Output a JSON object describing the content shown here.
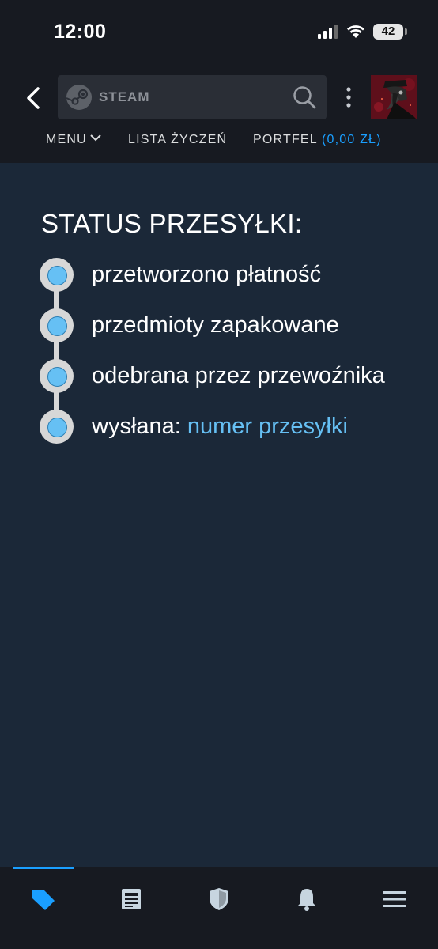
{
  "statusbar": {
    "time": "12:00",
    "battery": "42",
    "icons": [
      "signal-icon",
      "wifi-icon",
      "battery-icon"
    ]
  },
  "header": {
    "search_logo_text": "STEAM",
    "nav": {
      "menu_label": "MENU",
      "wishlist_label": "LISTA ŻYCZEŃ",
      "wallet_label": "PORTFEL",
      "wallet_balance": "(0,00 ZŁ)"
    }
  },
  "main": {
    "title": "STATUS PRZESYŁKI:",
    "steps": [
      {
        "label": "przetworzono płatność"
      },
      {
        "label": "przedmioty zapakowane"
      },
      {
        "label": "odebrana przez przewoźnika"
      },
      {
        "label": "wysłana:",
        "link": "numer przesyłki"
      }
    ]
  },
  "tabbar": {
    "tabs": [
      "store-tag-icon",
      "news-icon",
      "shield-icon",
      "bell-icon",
      "menu-icon"
    ],
    "active": "store-tag-icon"
  },
  "colors": {
    "background": "#1b2838",
    "header": "#171a21",
    "accent": "#1a9fff",
    "link": "#66c0f4",
    "timeline": "#d7d7d7"
  }
}
